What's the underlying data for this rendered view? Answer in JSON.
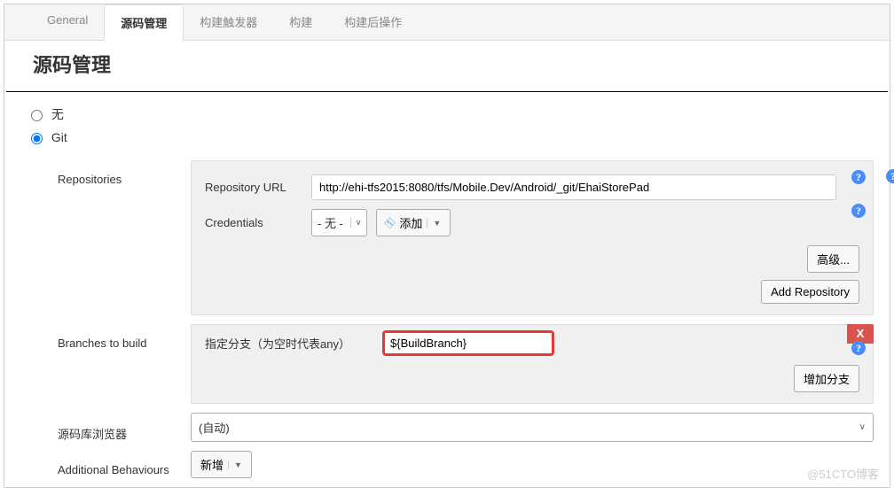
{
  "tabs": {
    "general": "General",
    "scm": "源码管理",
    "triggers": "构建触发器",
    "build": "构建",
    "postbuild": "构建后操作"
  },
  "section_title": "源码管理",
  "scm_options": {
    "none": "无",
    "git": "Git"
  },
  "repositories": {
    "label": "Repositories",
    "url_label": "Repository URL",
    "url_value": "http://ehi-tfs2015:8080/tfs/Mobile.Dev/Android/_git/EhaiStorePad",
    "credentials_label": "Credentials",
    "credentials_value": "- 无 -",
    "add_label": "添加",
    "advanced_label": "高级...",
    "add_repo_label": "Add Repository"
  },
  "branches": {
    "label": "Branches to build",
    "specifier_label": "指定分支（为空时代表any）",
    "specifier_value": "${BuildBranch}",
    "add_branch_label": "增加分支",
    "delete_label": "X"
  },
  "browser": {
    "label": "源码库浏览器",
    "value": "(自动)"
  },
  "behaviours": {
    "label": "Additional Behaviours",
    "add_label": "新增"
  },
  "watermark": "@51CTO博客"
}
